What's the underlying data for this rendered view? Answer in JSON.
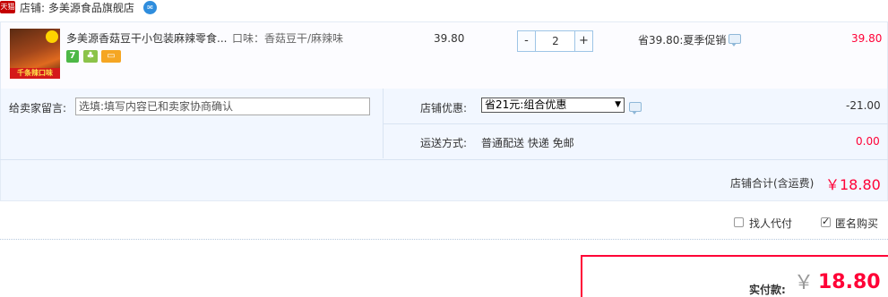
{
  "shop": {
    "badge": "天猫",
    "name_label": "店铺: 多美源食品旗舰店",
    "ww_icon": "wangwang-chat-icon"
  },
  "item": {
    "thumb_band": "千条辣口味",
    "title": "多美源香菇豆干小包装麻辣零食...",
    "sku": "口味：香菇豆干/麻辣味",
    "service_icons": [
      "7-day-return-icon",
      "guarantee-icon",
      "credit-card-icon"
    ],
    "service_7": "7",
    "unit_price": "39.80",
    "quantity": "2",
    "minus": "-",
    "plus": "+",
    "promotion": "省39.80:夏季促销",
    "total": "39.80"
  },
  "options": {
    "memo_label": "给卖家留言:",
    "memo_placeholder": "选填:填写内容已和卖家协商确认",
    "shop_discount_label": "店铺优惠:",
    "shop_discount_selected": "省21元:组合优惠",
    "shop_discount_amount": "-21.00",
    "shipping_label": "运送方式:",
    "shipping_value": "普通配送 快递 免邮",
    "shipping_amount": "0.00"
  },
  "summary": {
    "total_label": "店铺合计(含运费)",
    "total_value": "￥18.80",
    "proxy_label": "找人代付",
    "anonymous_label": "匿名购买",
    "anonymous_checked": true,
    "proxy_checked": false
  },
  "payment": {
    "label": "实付款:",
    "currency": "￥",
    "value": "18.80"
  },
  "colors": {
    "accent": "#ff0036",
    "tmall": "#c40000",
    "panel": "#f2f7ff"
  }
}
